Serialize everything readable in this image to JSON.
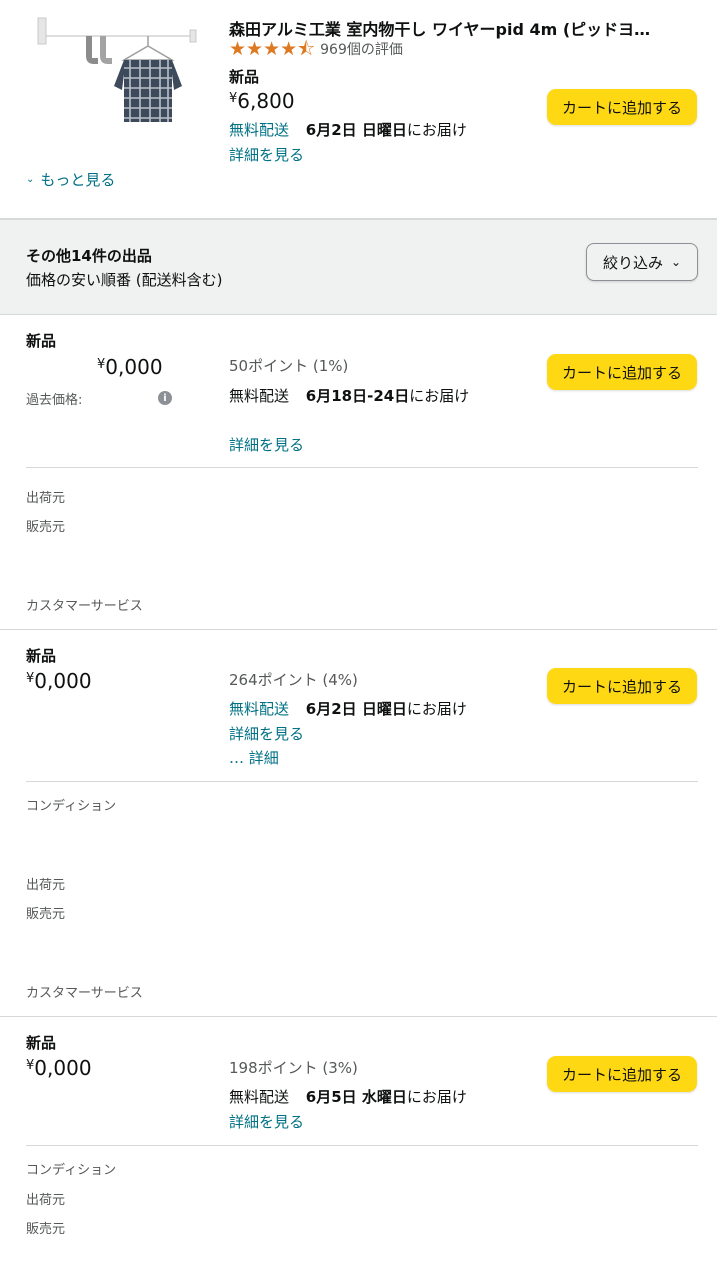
{
  "product": {
    "title": "森田アルミ工業 室内物干し ワイヤーpid 4m (ピッドヨ…",
    "rating_count": "969個の評価",
    "condition": "新品",
    "currency": "¥",
    "price": "6,800",
    "free_shipping": "無料配送",
    "delivery_date": "6月2日 日曜日",
    "delivery_suffix": "にお届け",
    "details_link": "詳細を見る",
    "add_to_cart": "カートに追加する",
    "see_more": "もっと見る"
  },
  "offers_header": {
    "title": "その他14件の出品",
    "sort": "価格の安い順番 (配送料含む)",
    "filter_button": "絞り込み"
  },
  "offers": [
    {
      "condition": "新品",
      "currency": "¥",
      "price": "0,000",
      "past_price_label": "過去価格:",
      "points": "50ポイント (1%)",
      "shipping_label": "無料配送",
      "delivery_date": "6月18日-24日",
      "delivery_suffix": "にお届け",
      "details_link": "詳細を見る",
      "add_to_cart": "カートに追加する",
      "ships_from": "出荷元",
      "sold_by": "販売元",
      "customer_service": "カスタマーサービス"
    },
    {
      "condition": "新品",
      "currency": "¥",
      "price": "0,000",
      "points": "264ポイント (4%)",
      "shipping_label": "無料配送",
      "delivery_date": "6月2日 日曜日",
      "delivery_suffix": "にお届け",
      "details_link": "詳細を見る",
      "more_details": "… 詳細",
      "add_to_cart": "カートに追加する",
      "condition_label": "コンディション",
      "ships_from": "出荷元",
      "sold_by": "販売元",
      "customer_service": "カスタマーサービス"
    },
    {
      "condition": "新品",
      "currency": "¥",
      "price": "0,000",
      "points": "198ポイント (3%)",
      "shipping_label": "無料配送",
      "delivery_date": "6月5日 水曜日",
      "delivery_suffix": "にお届け",
      "details_link": "詳細を見る",
      "add_to_cart": "カートに追加する",
      "condition_label": "コンディション",
      "ships_from": "出荷元",
      "sold_by": "販売元"
    }
  ],
  "colors": {
    "cart_button": "#ffd814",
    "link": "#007185",
    "star": "#de7921",
    "header_bg": "#f0f2f2"
  },
  "rating_value": 4.5,
  "rating_max": 5
}
